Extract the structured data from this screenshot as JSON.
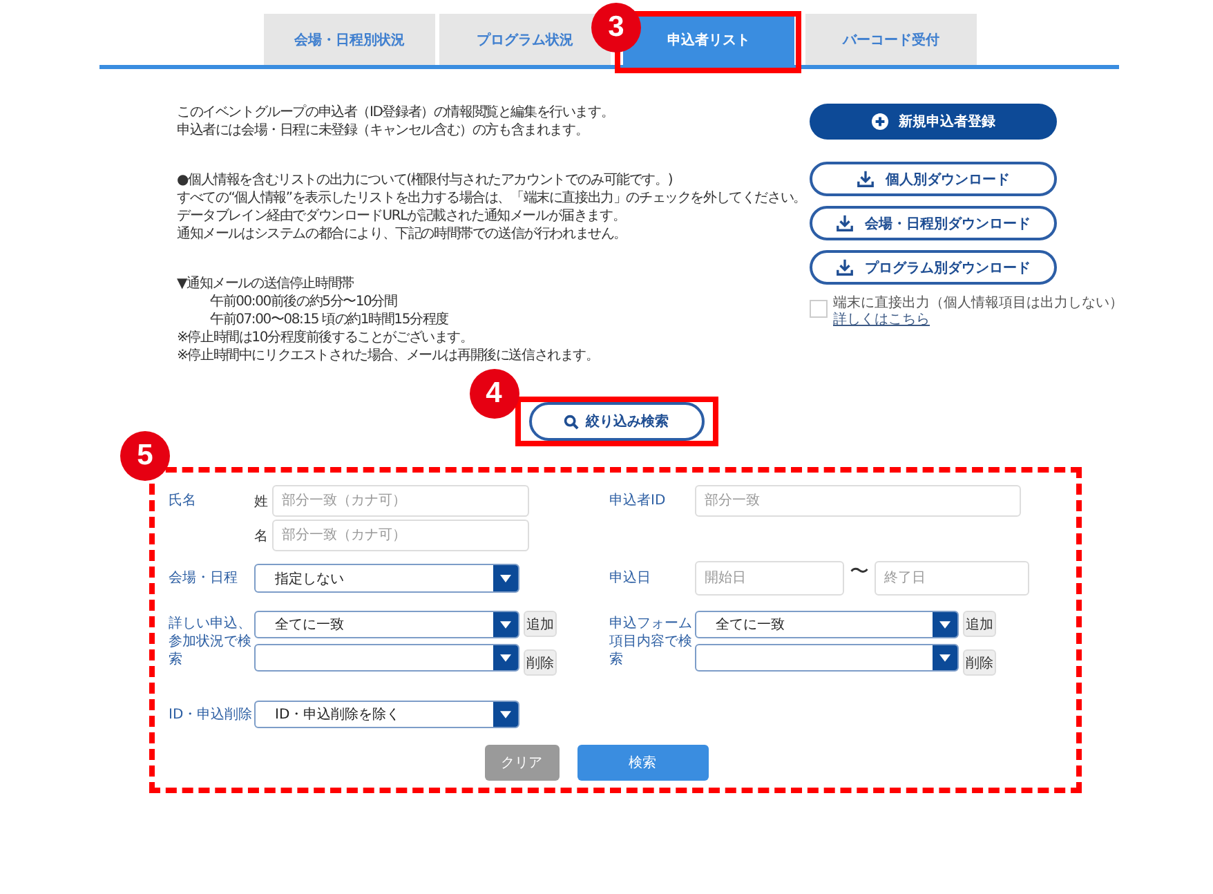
{
  "tabs": [
    {
      "label": "会場・日程別状況",
      "selected": false
    },
    {
      "label": "プログラム状況",
      "selected": false
    },
    {
      "label": "申込者リスト",
      "selected": true,
      "callout": {
        "number": "3",
        "kind": "solid"
      }
    },
    {
      "label": "バーコード受付",
      "selected": false
    }
  ],
  "description": {
    "intro": [
      "このイベントグループの申込者（ID登録者）の情報閲覧と編集を行います。",
      "申込者には会場・日程に未登録（キャンセル含む）の方も含まれます。"
    ],
    "notice_heading": "●個人情報を含むリストの出力について(権限付与されたアカウントでのみ可能です。)",
    "notice_lines": [
      "すべての“個人情報”を表示したリストを出力する場合は、「端末に直接出力」のチェックを外してください。",
      "データブレイン経由でダウンロードURLが記載された通知メールが届きます。",
      "通知メールはシステムの都合により、下記の時間帯での送信が行われません。"
    ],
    "schedule_heading": "▼通知メールの送信停止時間帯",
    "schedule_times": [
      "午前00:00前後の約5分〜10分間",
      "午前07:00〜08:15 頃の約1時間15分程度"
    ],
    "schedule_notes": [
      "※停止時間は10分程度前後することがございます。",
      "※停止時間中にリクエストされた場合、メールは再開後に送信されます。"
    ]
  },
  "actions": {
    "register_button": "新規申込者登録",
    "download_buttons": [
      "個人別ダウンロード",
      "会場・日程別ダウンロード",
      "プログラム別ダウンロード"
    ],
    "direct_output": {
      "label": "端末に直接出力（個人情報項目は出力しない）",
      "checked": false
    },
    "details_link": "詳しくはこちら"
  },
  "filter_toggle": {
    "label": "絞り込み検索",
    "callout": {
      "number": "4",
      "kind": "solid"
    }
  },
  "search_form": {
    "callout": {
      "number": "5",
      "kind": "dashed"
    },
    "name": {
      "label": "氏名",
      "last_name": {
        "label": "姓",
        "placeholder": "部分一致（カナ可）"
      },
      "first_name": {
        "label": "名",
        "placeholder": "部分一致（カナ可）"
      }
    },
    "applicant_id": {
      "label": "申込者ID",
      "placeholder": "部分一致"
    },
    "venue_date": {
      "label": "会場・日程",
      "value": "指定しない"
    },
    "application_date": {
      "label": "申込日",
      "start_placeholder": "開始日",
      "separator": "〜",
      "end_placeholder": "終了日"
    },
    "status_search": {
      "label": "詳しい申込、参加状況で検索",
      "match_value": "全てに一致",
      "add_button": "追加",
      "delete_button": "削除"
    },
    "form_item_search": {
      "label": "申込フォーム項目内容で検索",
      "match_value": "全てに一致",
      "add_button": "追加",
      "delete_button": "削除"
    },
    "deletion_filter": {
      "label": "ID・申込削除",
      "value": "ID・申込削除を除く"
    },
    "clear_button": "クリア",
    "search_button": "検索"
  }
}
